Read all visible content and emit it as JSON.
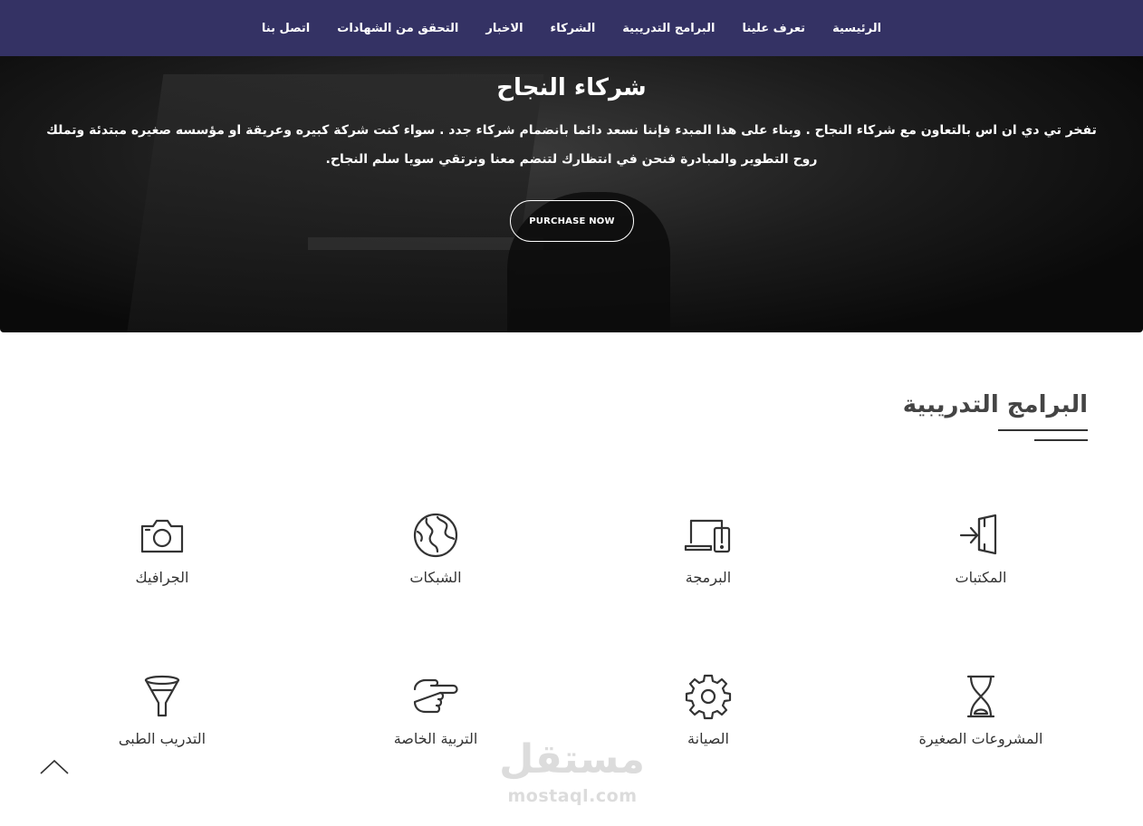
{
  "nav": {
    "items": [
      {
        "label": "الرئيسية"
      },
      {
        "label": "تعرف علينا"
      },
      {
        "label": "البرامج التدريبية"
      },
      {
        "label": "الشركاء"
      },
      {
        "label": "الاخبار"
      },
      {
        "label": "التحقق من الشهادات"
      },
      {
        "label": "اتصل بنا"
      }
    ]
  },
  "hero": {
    "title": "شركاء النجاح",
    "text": "تفخر تي دي ان اس بالتعاون مع شركاء النجاح . وبناء على هذا المبدء فإننا نسعد دائما بانضمام شركاء جدد . سواء كنت شركة كبيره وعريقة او مؤسسه صغيره مبتدئة وتملك روح التطوير والمبادرة فنحن في انتظارك لتنضم معنا ونرتقي سويا سلم النجاح.",
    "button_label": "PURCHASE NOW"
  },
  "programs": {
    "title": "البرامج التدريبية",
    "items": [
      {
        "label": "المكتبات",
        "icon": "door-enter-icon"
      },
      {
        "label": "البرمجة",
        "icon": "laptop-phone-icon"
      },
      {
        "label": "الشبكات",
        "icon": "globe-icon"
      },
      {
        "label": "الجرافيك",
        "icon": "camera-icon"
      },
      {
        "label": "المشروعات الصغيرة",
        "icon": "hourglass-icon"
      },
      {
        "label": "الصيانة",
        "icon": "gear-icon"
      },
      {
        "label": "التربية الخاصة",
        "icon": "pointing-hand-icon"
      },
      {
        "label": "التدريب الطبى",
        "icon": "funnel-icon"
      }
    ]
  },
  "watermark": {
    "arabic": "مستقل",
    "latin": "mostaql.com"
  },
  "colors": {
    "nav_bg": "#343264",
    "hero_bg": "#111111",
    "text_dark": "#333333"
  }
}
